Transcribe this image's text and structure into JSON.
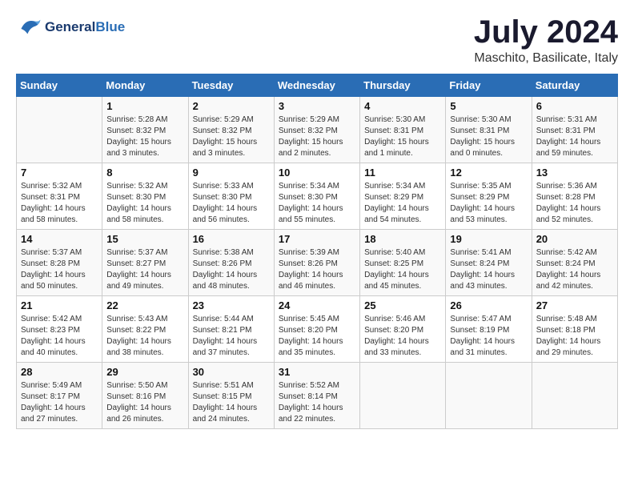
{
  "logo": {
    "line1": "General",
    "line2": "Blue"
  },
  "title": "July 2024",
  "location": "Maschito, Basilicate, Italy",
  "days_of_week": [
    "Sunday",
    "Monday",
    "Tuesday",
    "Wednesday",
    "Thursday",
    "Friday",
    "Saturday"
  ],
  "weeks": [
    [
      {
        "day": "",
        "info": ""
      },
      {
        "day": "1",
        "info": "Sunrise: 5:28 AM\nSunset: 8:32 PM\nDaylight: 15 hours\nand 3 minutes."
      },
      {
        "day": "2",
        "info": "Sunrise: 5:29 AM\nSunset: 8:32 PM\nDaylight: 15 hours\nand 3 minutes."
      },
      {
        "day": "3",
        "info": "Sunrise: 5:29 AM\nSunset: 8:32 PM\nDaylight: 15 hours\nand 2 minutes."
      },
      {
        "day": "4",
        "info": "Sunrise: 5:30 AM\nSunset: 8:31 PM\nDaylight: 15 hours\nand 1 minute."
      },
      {
        "day": "5",
        "info": "Sunrise: 5:30 AM\nSunset: 8:31 PM\nDaylight: 15 hours\nand 0 minutes."
      },
      {
        "day": "6",
        "info": "Sunrise: 5:31 AM\nSunset: 8:31 PM\nDaylight: 14 hours\nand 59 minutes."
      }
    ],
    [
      {
        "day": "7",
        "info": "Sunrise: 5:32 AM\nSunset: 8:31 PM\nDaylight: 14 hours\nand 58 minutes."
      },
      {
        "day": "8",
        "info": "Sunrise: 5:32 AM\nSunset: 8:30 PM\nDaylight: 14 hours\nand 58 minutes."
      },
      {
        "day": "9",
        "info": "Sunrise: 5:33 AM\nSunset: 8:30 PM\nDaylight: 14 hours\nand 56 minutes."
      },
      {
        "day": "10",
        "info": "Sunrise: 5:34 AM\nSunset: 8:30 PM\nDaylight: 14 hours\nand 55 minutes."
      },
      {
        "day": "11",
        "info": "Sunrise: 5:34 AM\nSunset: 8:29 PM\nDaylight: 14 hours\nand 54 minutes."
      },
      {
        "day": "12",
        "info": "Sunrise: 5:35 AM\nSunset: 8:29 PM\nDaylight: 14 hours\nand 53 minutes."
      },
      {
        "day": "13",
        "info": "Sunrise: 5:36 AM\nSunset: 8:28 PM\nDaylight: 14 hours\nand 52 minutes."
      }
    ],
    [
      {
        "day": "14",
        "info": "Sunrise: 5:37 AM\nSunset: 8:28 PM\nDaylight: 14 hours\nand 50 minutes."
      },
      {
        "day": "15",
        "info": "Sunrise: 5:37 AM\nSunset: 8:27 PM\nDaylight: 14 hours\nand 49 minutes."
      },
      {
        "day": "16",
        "info": "Sunrise: 5:38 AM\nSunset: 8:26 PM\nDaylight: 14 hours\nand 48 minutes."
      },
      {
        "day": "17",
        "info": "Sunrise: 5:39 AM\nSunset: 8:26 PM\nDaylight: 14 hours\nand 46 minutes."
      },
      {
        "day": "18",
        "info": "Sunrise: 5:40 AM\nSunset: 8:25 PM\nDaylight: 14 hours\nand 45 minutes."
      },
      {
        "day": "19",
        "info": "Sunrise: 5:41 AM\nSunset: 8:24 PM\nDaylight: 14 hours\nand 43 minutes."
      },
      {
        "day": "20",
        "info": "Sunrise: 5:42 AM\nSunset: 8:24 PM\nDaylight: 14 hours\nand 42 minutes."
      }
    ],
    [
      {
        "day": "21",
        "info": "Sunrise: 5:42 AM\nSunset: 8:23 PM\nDaylight: 14 hours\nand 40 minutes."
      },
      {
        "day": "22",
        "info": "Sunrise: 5:43 AM\nSunset: 8:22 PM\nDaylight: 14 hours\nand 38 minutes."
      },
      {
        "day": "23",
        "info": "Sunrise: 5:44 AM\nSunset: 8:21 PM\nDaylight: 14 hours\nand 37 minutes."
      },
      {
        "day": "24",
        "info": "Sunrise: 5:45 AM\nSunset: 8:20 PM\nDaylight: 14 hours\nand 35 minutes."
      },
      {
        "day": "25",
        "info": "Sunrise: 5:46 AM\nSunset: 8:20 PM\nDaylight: 14 hours\nand 33 minutes."
      },
      {
        "day": "26",
        "info": "Sunrise: 5:47 AM\nSunset: 8:19 PM\nDaylight: 14 hours\nand 31 minutes."
      },
      {
        "day": "27",
        "info": "Sunrise: 5:48 AM\nSunset: 8:18 PM\nDaylight: 14 hours\nand 29 minutes."
      }
    ],
    [
      {
        "day": "28",
        "info": "Sunrise: 5:49 AM\nSunset: 8:17 PM\nDaylight: 14 hours\nand 27 minutes."
      },
      {
        "day": "29",
        "info": "Sunrise: 5:50 AM\nSunset: 8:16 PM\nDaylight: 14 hours\nand 26 minutes."
      },
      {
        "day": "30",
        "info": "Sunrise: 5:51 AM\nSunset: 8:15 PM\nDaylight: 14 hours\nand 24 minutes."
      },
      {
        "day": "31",
        "info": "Sunrise: 5:52 AM\nSunset: 8:14 PM\nDaylight: 14 hours\nand 22 minutes."
      },
      {
        "day": "",
        "info": ""
      },
      {
        "day": "",
        "info": ""
      },
      {
        "day": "",
        "info": ""
      }
    ]
  ]
}
